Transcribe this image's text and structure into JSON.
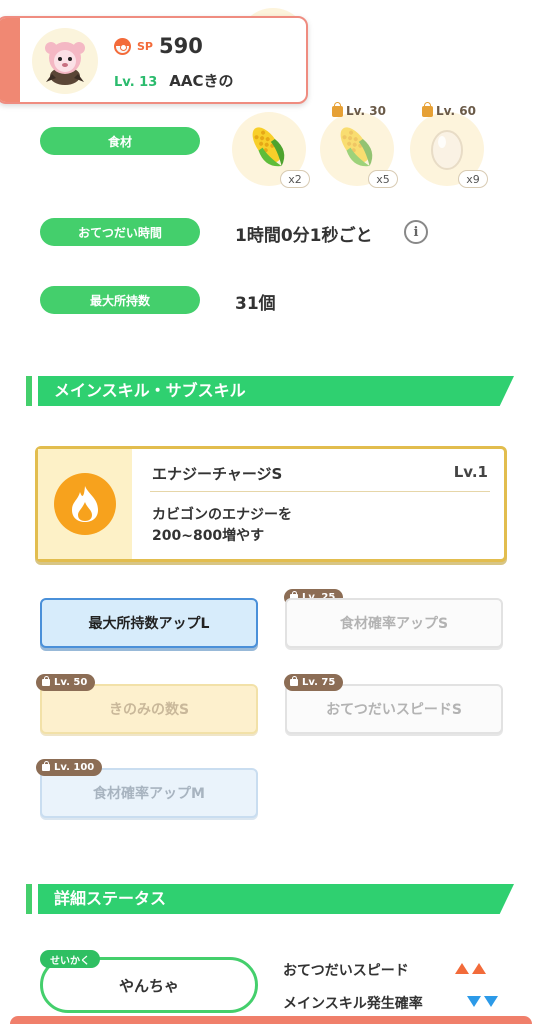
{
  "header": {
    "sp_label": "SP",
    "sp_value": "590",
    "level": "Lv. 13",
    "nickname": "AACきの",
    "avatar_icon": "pokemon-avatar-icon"
  },
  "ingredients": {
    "label": "食材",
    "items": [
      {
        "name": "corn",
        "unlock_level": "",
        "count": "x2",
        "locked": false
      },
      {
        "name": "corn",
        "unlock_level": "Lv. 30",
        "count": "x5",
        "locked": true
      },
      {
        "name": "egg",
        "unlock_level": "Lv. 60",
        "count": "x9",
        "locked": true
      }
    ]
  },
  "help_time": {
    "label": "おてつだい時間",
    "value": "1時間0分1秒ごと",
    "info_icon": "i"
  },
  "max_carry": {
    "label": "最大所持数",
    "value": "31個"
  },
  "skills_section": {
    "title": "メインスキル・サブスキル"
  },
  "main_skill": {
    "name": "エナジーチャージS",
    "level": "Lv.1",
    "desc_line1": "カビゴンのエナジーを",
    "desc_line2": "200~800増やす",
    "icon": "fire-icon"
  },
  "sub_skills": [
    {
      "label": "最大所持数アップL",
      "unlock": "",
      "style": "blue"
    },
    {
      "label": "食材確率アップS",
      "unlock": "Lv. 25",
      "style": "gray"
    },
    {
      "label": "きのみの数S",
      "unlock": "Lv. 50",
      "style": "yellow"
    },
    {
      "label": "おてつだいスピードS",
      "unlock": "Lv. 75",
      "style": "gray"
    },
    {
      "label": "食材確率アップM",
      "unlock": "Lv. 100",
      "style": "lightblue"
    }
  ],
  "detail_section": {
    "title": "詳細ステータス"
  },
  "nature": {
    "tag": "せいかく",
    "value": "やんちゃ",
    "effects": [
      {
        "label": "おてつだいスピード",
        "direction": "up"
      },
      {
        "label": "メインスキル発生確率",
        "direction": "down"
      }
    ]
  },
  "colors": {
    "accent_green": "#2fd070",
    "header_border": "#ef8c80",
    "skill_border": "#e2bd4e",
    "up": "#f26b3a",
    "down": "#2c9ae8"
  }
}
